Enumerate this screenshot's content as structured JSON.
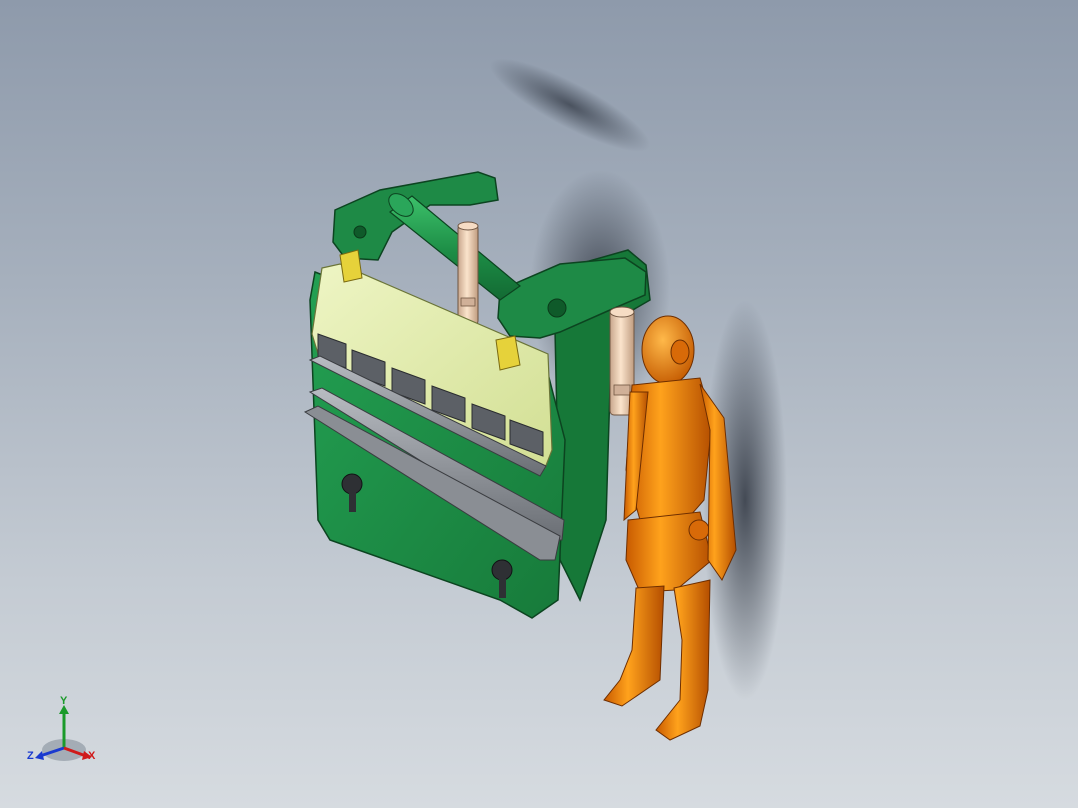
{
  "viewport": {
    "background_top": "#8e9aab",
    "background_bottom": "#d6dbe0",
    "model_description_label": ""
  },
  "model": {
    "machine_color": "#1e8a46",
    "ram_color": "#e4eeb0",
    "cylinder_color": "#f0d2b4",
    "mannequin_color": "#f08a10"
  },
  "triad": {
    "y_label": "Y",
    "z_label": "Z",
    "x_label": "X",
    "y_color": "#1a9a2a",
    "z_color": "#1a3ad0",
    "x_color": "#d01a1a"
  }
}
